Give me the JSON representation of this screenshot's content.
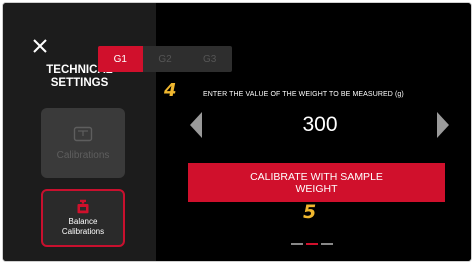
{
  "sidebar": {
    "title_line1": "TECHNICAL",
    "title_line2": "SETTINGS",
    "items": [
      {
        "label": "Calibrations",
        "icon": "scale-icon",
        "state": "disabled"
      },
      {
        "label_line1": "Balance",
        "label_line2": "Calibrations",
        "icon": "balance-weight-icon",
        "state": "selected"
      }
    ]
  },
  "main": {
    "tabs": [
      {
        "label": "G1",
        "active": true
      },
      {
        "label": "G2",
        "active": false
      },
      {
        "label": "G3",
        "active": false
      }
    ],
    "step_badges": {
      "instruction": "4",
      "action": "5"
    },
    "instruction": "ENTER THE VALUE OF THE WEIGHT TO BE MEASURED (g)",
    "weight_value": "300",
    "calibrate_line1": "CALIBRATE WITH SAMPLE",
    "calibrate_line2": "WEIGHT",
    "pager": {
      "total": 3,
      "active_index": 1
    }
  },
  "colors": {
    "accent": "#d0102c",
    "step_badge": "#f0b72f",
    "sidebar_bg": "#1c1c1c",
    "main_bg": "#000000"
  }
}
